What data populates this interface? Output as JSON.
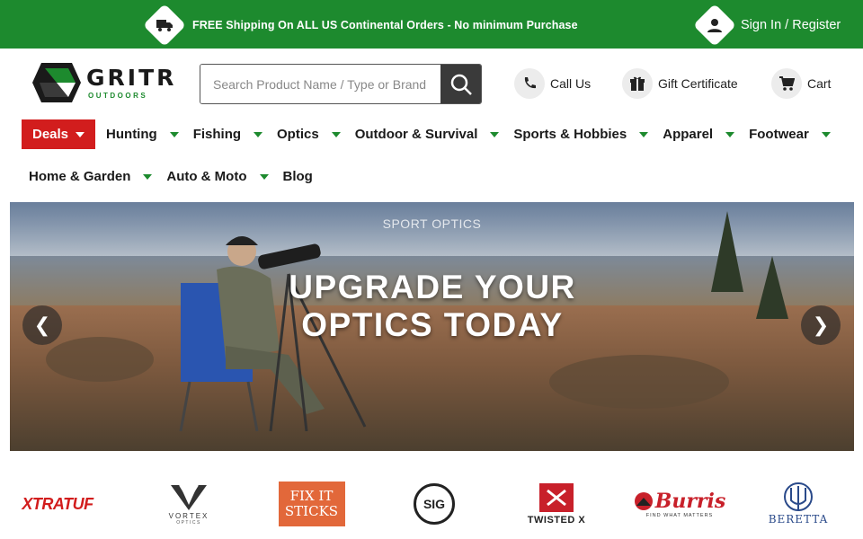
{
  "topbar": {
    "shipping_text": "FREE Shipping On ALL US Continental Orders - No minimum Purchase",
    "signin_text": "Sign In / Register",
    "bg_color": "#1d8a2e"
  },
  "logo": {
    "name": "GRITR",
    "tagline": "OUTDOORS"
  },
  "search": {
    "placeholder": "Search Product Name / Type or Brand",
    "value": ""
  },
  "header_links": {
    "call": "Call Us",
    "gift": "Gift Certificate",
    "cart": "Cart"
  },
  "nav": {
    "deals": "Deals",
    "row1": [
      "Hunting",
      "Fishing",
      "Optics",
      "Outdoor & Survival",
      "Sports & Hobbies",
      "Apparel",
      "Footwear"
    ],
    "row2": [
      "Home & Garden",
      "Auto & Moto",
      "Blog"
    ]
  },
  "banner": {
    "eyebrow": "SPORT OPTICS",
    "headline": "UPGRADE YOUR OPTICS TODAY",
    "prev": "❮",
    "next": "❯"
  },
  "brands": {
    "xtratuf": "XTRATUF",
    "vortex": "VORTEX",
    "vortex_sub": "OPTICS",
    "fixit_1": "FIX IT",
    "fixit_2": "STICKS",
    "sig": "SIG",
    "twisted": "TWISTED X",
    "burris": "Burris",
    "burris_sub": "FIND WHAT MATTERS",
    "beretta": "BERETTA"
  },
  "colors": {
    "accent_green": "#1d8a2e",
    "deals_red": "#d21d1d"
  }
}
